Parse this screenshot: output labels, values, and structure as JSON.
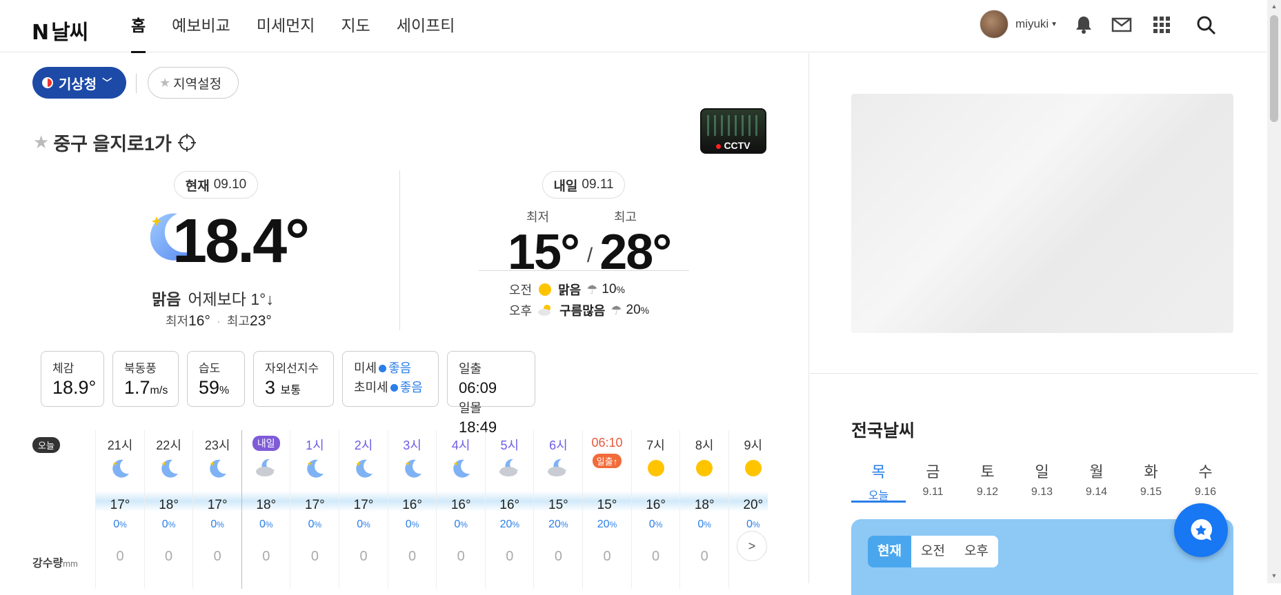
{
  "header": {
    "logo_n": "N",
    "logo_text": "날씨",
    "nav": [
      "홈",
      "예보비교",
      "미세먼지",
      "지도",
      "세이프티"
    ],
    "username": "miyuki"
  },
  "controls": {
    "source_label": "기상청",
    "area_setting": "지역설정"
  },
  "location": "중구 을지로1가",
  "cctv_label": "CCTV",
  "current": {
    "pill_label": "현재",
    "pill_date": "09.10",
    "temp": "18.4°",
    "condition": "맑음",
    "compare": "어제보다 1°↓",
    "min_label": "최저",
    "min": "16°",
    "max_label": "최고",
    "max": "23°"
  },
  "tomorrow": {
    "pill_label": "내일",
    "pill_date": "09.11",
    "min_label": "최저",
    "max_label": "최고",
    "min": "15°",
    "max": "28°",
    "am_label": "오전",
    "am_cond": "맑음",
    "am_pct": "10",
    "pm_label": "오후",
    "pm_cond": "구름많음",
    "pm_pct": "20",
    "pct_unit": "%"
  },
  "cards": {
    "feels_label": "체감",
    "feels": "18.9°",
    "wind_label": "북동풍",
    "wind": "1.7",
    "wind_unit": "m/s",
    "humidity_label": "습도",
    "humidity": "59",
    "humidity_unit": "%",
    "uv_label": "자외선지수",
    "uv": "3",
    "uv_level": "보통",
    "pm_label": "미세",
    "pm_value": "좋음",
    "upm_label": "초미세",
    "upm_value": "좋음",
    "sunrise_label": "일출",
    "sunrise": "06:09",
    "sunset_label": "일몰",
    "sunset": "18:49"
  },
  "hourly": {
    "today_badge": "오늘",
    "rain_label": "강수량",
    "rain_unit": "mm",
    "items": [
      {
        "hour": "21시",
        "icon": "moon-icon",
        "temp": "17°",
        "pct": "0",
        "rain": "0"
      },
      {
        "hour": "22시",
        "icon": "moon-icon",
        "temp": "18°",
        "pct": "0",
        "rain": "0"
      },
      {
        "hour": "23시",
        "icon": "moon-icon",
        "temp": "17°",
        "pct": "0",
        "rain": "0"
      },
      {
        "hour": "내일",
        "icon": "cloud-moon-icon",
        "temp": "18°",
        "pct": "0",
        "rain": "0"
      },
      {
        "hour": "1시",
        "icon": "moon-icon",
        "temp": "17°",
        "pct": "0",
        "rain": "0"
      },
      {
        "hour": "2시",
        "icon": "moon-icon",
        "temp": "17°",
        "pct": "0",
        "rain": "0"
      },
      {
        "hour": "3시",
        "icon": "moon-icon",
        "temp": "16°",
        "pct": "0",
        "rain": "0"
      },
      {
        "hour": "4시",
        "icon": "moon-icon",
        "temp": "16°",
        "pct": "0",
        "rain": "0"
      },
      {
        "hour": "5시",
        "icon": "cloud-moon-icon",
        "temp": "16°",
        "pct": "20",
        "rain": "0"
      },
      {
        "hour": "6시",
        "icon": "cloud-moon-icon",
        "temp": "15°",
        "pct": "20",
        "rain": "0"
      },
      {
        "hour": "06:10",
        "icon": "sunrise-icon",
        "sunrise_badge": "일출↑",
        "temp": "15°",
        "pct": "20",
        "rain": "0"
      },
      {
        "hour": "7시",
        "icon": "sun-icon",
        "temp": "16°",
        "pct": "0",
        "rain": "0"
      },
      {
        "hour": "8시",
        "icon": "sun-icon",
        "temp": "18°",
        "pct": "0",
        "rain": "0"
      },
      {
        "hour": "9시",
        "icon": "sun-icon",
        "temp": "20°",
        "pct": "0",
        "rain": "0"
      }
    ]
  },
  "national": {
    "title": "전국날씨",
    "days": [
      {
        "weekday": "목",
        "date": "오늘"
      },
      {
        "weekday": "금",
        "date": "9.11"
      },
      {
        "weekday": "토",
        "date": "9.12"
      },
      {
        "weekday": "일",
        "date": "9.13"
      },
      {
        "weekday": "월",
        "date": "9.14"
      },
      {
        "weekday": "화",
        "date": "9.15"
      },
      {
        "weekday": "수",
        "date": "9.16"
      }
    ],
    "segments": [
      "현재",
      "오전",
      "오후"
    ]
  },
  "colors": {
    "brand_blue": "#1d4aa7",
    "accent_blue": "#2a7ee8",
    "night_purple": "#6c5ce7",
    "sunrise_orange": "#e8583a",
    "panel_blue": "#8ec8f5"
  }
}
